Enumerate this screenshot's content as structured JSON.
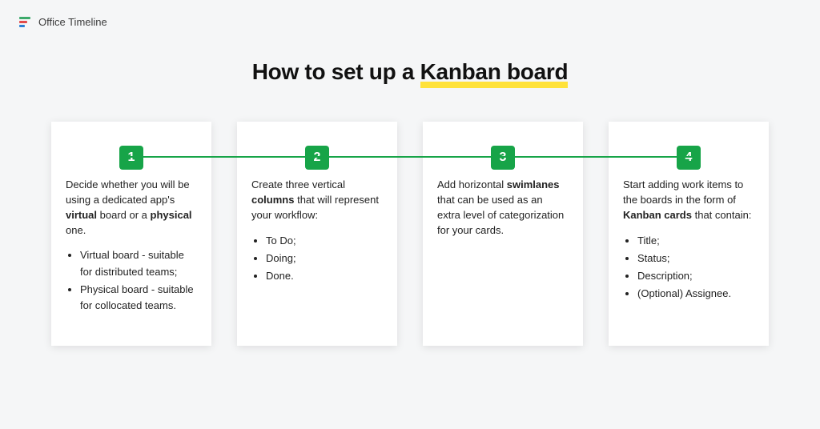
{
  "brand": {
    "name": "Office Timeline"
  },
  "title": {
    "prefix": "How to set up a ",
    "highlight": "Kanban board"
  },
  "steps": [
    {
      "num": "1",
      "desc_html": "Decide whether you will be using a dedicated app's <b>virtual</b> board or a <b>physical</b> one.",
      "bullets": [
        "Virtual board - suitable for distributed teams;",
        "Physical board - suitable for collocated teams."
      ]
    },
    {
      "num": "2",
      "desc_html": "Create three vertical <b>columns</b> that will represent your workflow:",
      "bullets": [
        "To Do;",
        "Doing;",
        "Done."
      ]
    },
    {
      "num": "3",
      "desc_html": "Add horizontal <b>swimlanes</b> that can be used as an extra level of categorization for your cards.",
      "bullets": []
    },
    {
      "num": "4",
      "desc_html": "Start adding work items to the boards in the form of <b>Kanban cards</b> that contain:",
      "bullets": [
        "Title;",
        "Status;",
        "Description;",
        "(Optional) Assignee."
      ]
    }
  ]
}
